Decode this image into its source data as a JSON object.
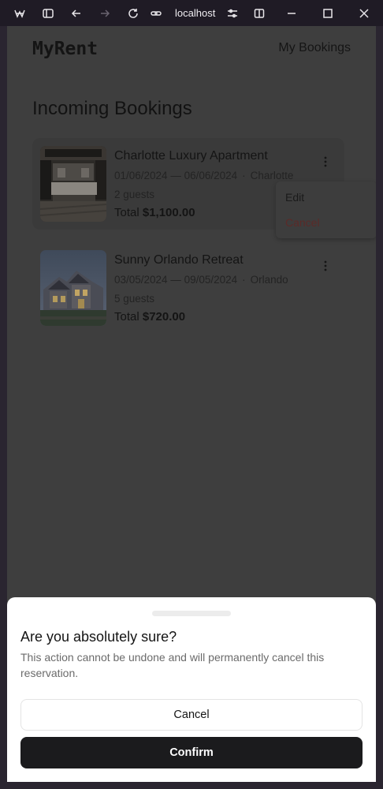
{
  "browser": {
    "url": "localhost"
  },
  "app": {
    "brand": "MyRent",
    "nav_link": "My Bookings",
    "page_title": "Incoming Bookings"
  },
  "bookings": [
    {
      "title": "Charlotte Luxury Apartment",
      "dates": "01/06/2024 — 06/06/2024",
      "city": "Charlotte",
      "guests": "2 guests",
      "total_label": "Total",
      "total_value": "$1,100.00"
    },
    {
      "title": "Sunny Orlando Retreat",
      "dates": "03/05/2024 — 09/05/2024",
      "city": "Orlando",
      "guests": "5 guests",
      "total_label": "Total",
      "total_value": "$720.00"
    }
  ],
  "menu": {
    "edit": "Edit",
    "cancel": "Cancel"
  },
  "dialog": {
    "title": "Are you absolutely sure?",
    "description": "This action cannot be undone and will permanently cancel this reservation.",
    "cancel_label": "Cancel",
    "confirm_label": "Confirm"
  },
  "colors": {
    "overlay": "#3e3e3e",
    "confirm_bg": "#1b1b1d",
    "destructive": "#5b2a28"
  }
}
